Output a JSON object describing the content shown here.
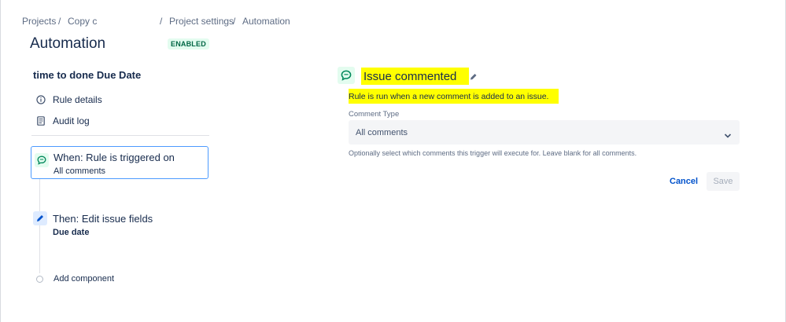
{
  "breadcrumb": {
    "projects": "Projects",
    "sep1": "/",
    "project": "Copy c",
    "sep2": "/",
    "settings": "Project settings",
    "sep3": "/",
    "automation": "Automation"
  },
  "page": {
    "title": "Automation",
    "status": "ENABLED"
  },
  "sidebar": {
    "rule_name": "time to done Due Date",
    "items": [
      {
        "label": "Rule details",
        "icon": "info-icon"
      },
      {
        "label": "Audit log",
        "icon": "document-icon"
      }
    ]
  },
  "components": {
    "trigger": {
      "title": "When: Rule is triggered on",
      "subtitle": "All comments",
      "icon": "comment-icon"
    },
    "action": {
      "title": "Then: Edit issue fields",
      "subtitle": "Due date",
      "icon": "pencil-icon"
    },
    "add_label": "Add component"
  },
  "detail": {
    "title": "Issue commented",
    "description": "Rule is run when a new comment is added to an issue.",
    "field_label": "Comment Type",
    "field_value": "All comments",
    "helper": "Optionally select which comments this trigger will execute for. Leave blank for all comments.",
    "cancel_label": "Cancel",
    "save_label": "Save"
  },
  "colors": {
    "trigger_green": "#00875a",
    "action_blue": "#0052cc",
    "highlight": "#ffff00",
    "selected_border": "#4c9aff",
    "link_blue": "#0052cc"
  }
}
